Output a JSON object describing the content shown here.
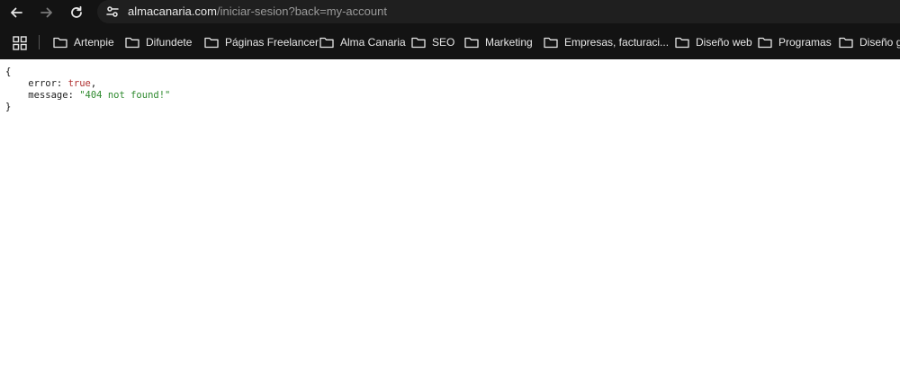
{
  "url": {
    "host": "almacanaria.com",
    "path": "/iniciar-sesion?back=my-account"
  },
  "bookmarks": [
    {
      "label": "Artenpie"
    },
    {
      "label": "Difundete"
    },
    {
      "label": "Páginas Freelancer"
    },
    {
      "label": "Alma Canaria"
    },
    {
      "label": "SEO"
    },
    {
      "label": "Marketing"
    },
    {
      "label": "Empresas, facturaci..."
    },
    {
      "label": "Diseño web"
    },
    {
      "label": "Programas"
    },
    {
      "label": "Diseño gr"
    }
  ],
  "response": {
    "open_brace": "{",
    "close_brace": "}",
    "error_key": "error",
    "error_value": "true",
    "message_key": "message",
    "message_value": "\"404 not found!\""
  },
  "colors": {
    "chrome_bg": "#131313",
    "omnibox_bg": "#1f1f1f",
    "json_bool": "#b03030",
    "json_string": "#2f8a2f"
  }
}
